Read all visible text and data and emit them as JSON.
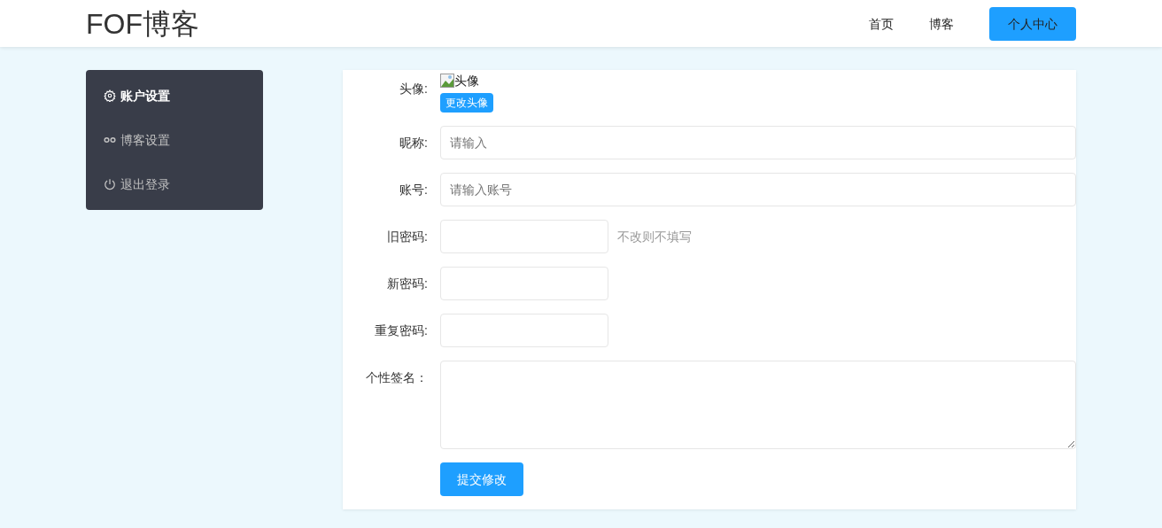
{
  "header": {
    "logo": "FOF博客",
    "nav": [
      {
        "label": "首页",
        "selected": false
      },
      {
        "label": "博客",
        "selected": false
      },
      {
        "label": "个人中心",
        "selected": true
      }
    ]
  },
  "sidebar": {
    "items": [
      {
        "label": "账户设置",
        "kind": "gear",
        "selected": true
      },
      {
        "label": "博客设置",
        "kind": "link",
        "selected": false
      },
      {
        "label": "退出登录",
        "kind": "power",
        "selected": false
      }
    ]
  },
  "form": {
    "fields": [
      {
        "kind": "avatar",
        "label": "头像:",
        "image_alt": "头像",
        "button": "更改头像"
      },
      {
        "kind": "text",
        "label": "昵称:",
        "placeholder": "请输入"
      },
      {
        "kind": "text",
        "label": "账号:",
        "placeholder": "请输入账号"
      },
      {
        "kind": "short",
        "label": "旧密码:",
        "hint": "不改则不填写"
      },
      {
        "kind": "short",
        "label": "新密码:"
      },
      {
        "kind": "short",
        "label": "重复密码:"
      },
      {
        "kind": "textarea",
        "label": "个性签名："
      }
    ],
    "submit": "提交修改"
  }
}
